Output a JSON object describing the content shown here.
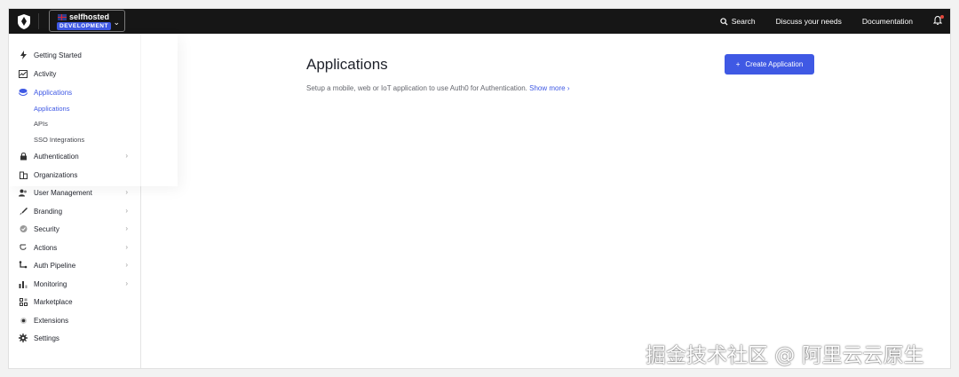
{
  "topbar": {
    "tenant_name": "selfhosted",
    "tenant_env": "DEVELOPMENT",
    "search_label": "Search",
    "discuss_label": "Discuss your needs",
    "docs_label": "Documentation"
  },
  "sidebar": {
    "items": [
      {
        "label": "Getting Started",
        "icon": "bolt-icon"
      },
      {
        "label": "Activity",
        "icon": "activity-icon"
      },
      {
        "label": "Applications",
        "icon": "layers-icon"
      },
      {
        "label": "Authentication",
        "icon": "lock-icon"
      },
      {
        "label": "Organizations",
        "icon": "building-icon"
      },
      {
        "label": "User Management",
        "icon": "users-icon"
      },
      {
        "label": "Branding",
        "icon": "brush-icon"
      },
      {
        "label": "Security",
        "icon": "shield-icon"
      },
      {
        "label": "Actions",
        "icon": "actions-icon"
      },
      {
        "label": "Auth Pipeline",
        "icon": "pipeline-icon"
      },
      {
        "label": "Monitoring",
        "icon": "bar-chart-icon"
      },
      {
        "label": "Marketplace",
        "icon": "grid-icon"
      },
      {
        "label": "Extensions",
        "icon": "extension-icon"
      },
      {
        "label": "Settings",
        "icon": "gear-icon"
      }
    ],
    "sub_items": [
      {
        "label": "Applications"
      },
      {
        "label": "APIs"
      },
      {
        "label": "SSO Integrations"
      }
    ]
  },
  "main": {
    "title": "Applications",
    "description": "Setup a mobile, web or IoT application to use Auth0 for Authentication.",
    "show_more": "Show more",
    "create_button": "Create Application"
  },
  "watermark": "掘金技术社区 @ 阿里云云原生",
  "colors": {
    "accent": "#3f59e4",
    "topbar": "#161616"
  }
}
